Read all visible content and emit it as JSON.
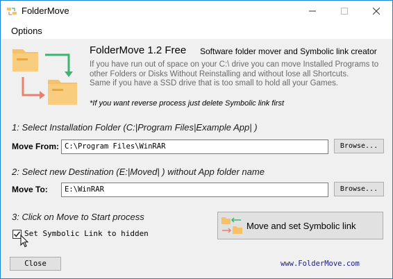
{
  "window": {
    "title": "FolderMove",
    "icon": "foldermove-app-icon",
    "controls": [
      "minimize-icon",
      "maximize-icon",
      "close-icon"
    ]
  },
  "menu": {
    "options_label": "Options"
  },
  "header": {
    "app_name": "FolderMove 1.2 Free",
    "tagline": "Software folder mover and Symbolic link creator",
    "description": [
      "If you have run out of space on your C:\\ drive you can move Installed Programs to",
      "other Folders or Disks Without Reinstalling and without lose all Shortcuts.",
      "Same if you have a SSD drive that is too small to hold all your Games."
    ],
    "reverse_note": "*If you want reverse process just delete Symbolic link first"
  },
  "step1": {
    "label": "1: Select Installation Folder (C:|Program Files|Example App| )",
    "field_label": "Move From:",
    "value": "C:\\Program Files\\WinRAR",
    "browse_label": "Browse..."
  },
  "step2": {
    "label": "2: Select new Destination (E:|Moved| ) without App folder name",
    "field_label": "Move To:",
    "value": "E:\\WinRAR",
    "browse_label": "Browse..."
  },
  "step3": {
    "label": "3: Click on Move to Start process",
    "checkbox_label": "Set Symbolic Link to hidden",
    "checkbox_checked": true,
    "move_button_label": "Move and set Symbolic link"
  },
  "footer": {
    "close_label": "Close",
    "site": "www.FolderMove.com"
  },
  "colors": {
    "folder": "#f5c26b",
    "folder_tab": "#e3a84a",
    "arrow_green": "#3cb371",
    "arrow_red": "#e9806e",
    "accent_border": "#1883d7"
  }
}
